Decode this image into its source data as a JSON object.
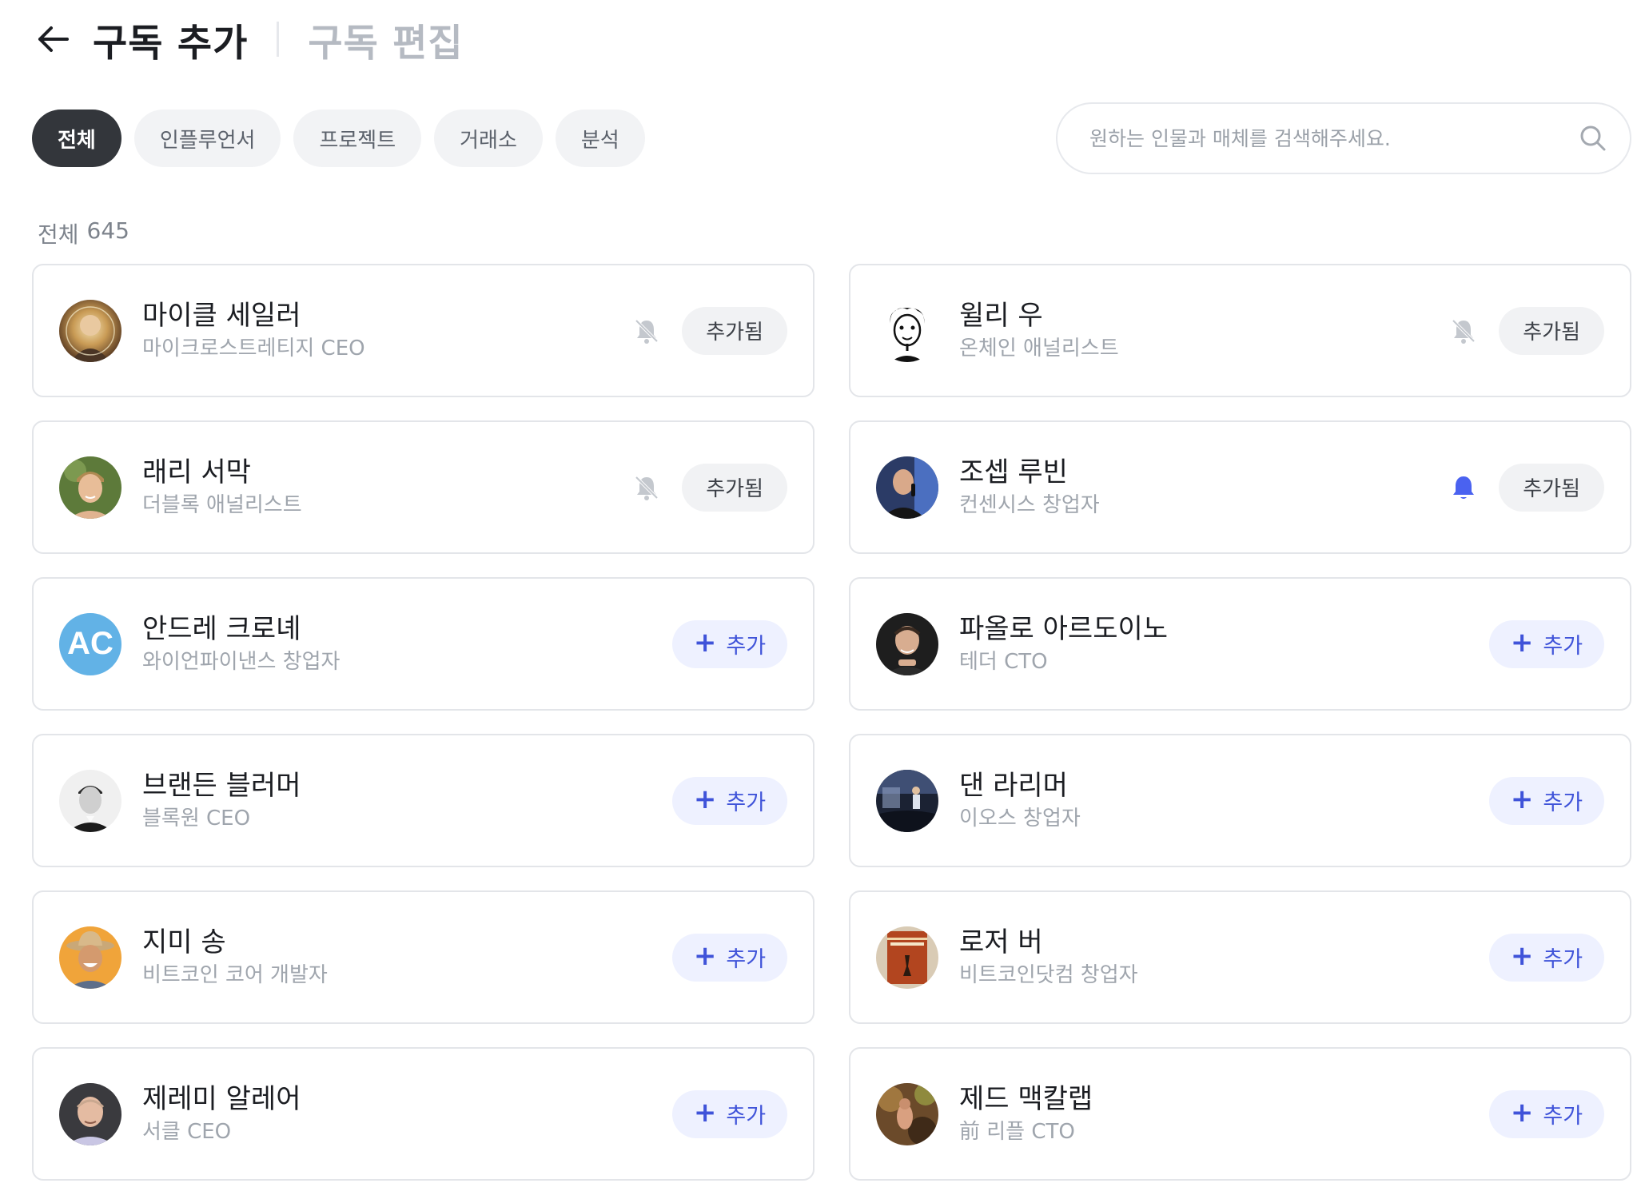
{
  "header": {
    "title_active": "구독 추가",
    "title_inactive": "구독 편집"
  },
  "filters": [
    {
      "label": "전체",
      "active": true
    },
    {
      "label": "인플루언서",
      "active": false
    },
    {
      "label": "프로젝트",
      "active": false
    },
    {
      "label": "거래소",
      "active": false
    },
    {
      "label": "분석",
      "active": false
    }
  ],
  "search": {
    "placeholder": "원하는 인물과 매체를 검색해주세요.",
    "icon": "search-icon"
  },
  "count": {
    "label": "전체",
    "value": "645"
  },
  "labels": {
    "added": "추가됨",
    "add": "추가",
    "add_icon": "+"
  },
  "colors": {
    "accent": "#3f53d9",
    "add_bg": "#eef1ff",
    "bell_active": "#4a62f0",
    "bell_muted": "#c4c8ce",
    "chip_active": "#33363b"
  },
  "profiles": [
    {
      "name": "마이클 세일러",
      "role": "마이크로스트레티지 CEO",
      "subscribed": true,
      "notify": false,
      "avatar": "photo"
    },
    {
      "name": "윌리 우",
      "role": "온체인 애널리스트",
      "subscribed": true,
      "notify": false,
      "avatar": "photo"
    },
    {
      "name": "래리 서막",
      "role": "더블록 애널리스트",
      "subscribed": true,
      "notify": false,
      "avatar": "photo"
    },
    {
      "name": "조셉 루빈",
      "role": "컨센시스 창업자",
      "subscribed": true,
      "notify": true,
      "avatar": "photo"
    },
    {
      "name": "안드레 크로녜",
      "role": "와이언파이낸스 창업자",
      "subscribed": false,
      "notify": false,
      "avatar": "initials",
      "initials": "AC"
    },
    {
      "name": "파올로 아르도이노",
      "role": "테더 CTO",
      "subscribed": false,
      "notify": false,
      "avatar": "photo"
    },
    {
      "name": "브랜든 블러머",
      "role": "블록원 CEO",
      "subscribed": false,
      "notify": false,
      "avatar": "photo"
    },
    {
      "name": "댄 라리머",
      "role": "이오스 창업자",
      "subscribed": false,
      "notify": false,
      "avatar": "photo"
    },
    {
      "name": "지미 송",
      "role": "비트코인 코어 개발자",
      "subscribed": false,
      "notify": false,
      "avatar": "photo"
    },
    {
      "name": "로저 버",
      "role": "비트코인닷컴 창업자",
      "subscribed": false,
      "notify": false,
      "avatar": "photo"
    },
    {
      "name": "제레미 알레어",
      "role": "서클 CEO",
      "subscribed": false,
      "notify": false,
      "avatar": "photo"
    },
    {
      "name": "제드 맥칼랩",
      "role": "前 리플 CTO",
      "subscribed": false,
      "notify": false,
      "avatar": "photo"
    }
  ]
}
